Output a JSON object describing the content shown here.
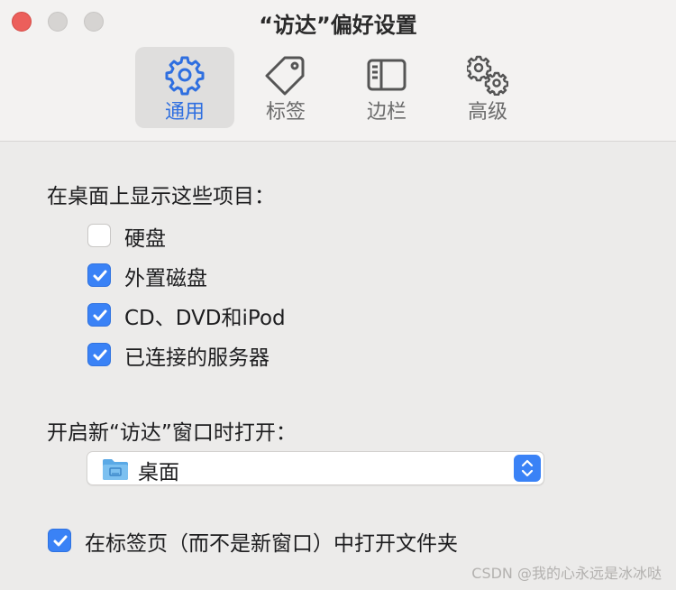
{
  "window": {
    "title": "“访达”偏好设置"
  },
  "toolbar": {
    "tabs": [
      {
        "label": "通用",
        "icon": "gear-icon",
        "selected": true
      },
      {
        "label": "标签",
        "icon": "tag-icon",
        "selected": false
      },
      {
        "label": "边栏",
        "icon": "sidebar-icon",
        "selected": false
      },
      {
        "label": "高级",
        "icon": "gears-advanced-icon",
        "selected": false
      }
    ]
  },
  "desktop_section": {
    "heading": "在桌面上显示这些项目：",
    "items": [
      {
        "label": "硬盘",
        "checked": false
      },
      {
        "label": "外置磁盘",
        "checked": true
      },
      {
        "label": "CD、DVD和iPod",
        "checked": true
      },
      {
        "label": "已连接的服务器",
        "checked": true
      }
    ]
  },
  "new_window_section": {
    "heading": "开启新“访达”窗口时打开：",
    "selected_value": "桌面",
    "icon": "desktop-folder-icon"
  },
  "tabs_option": {
    "label": "在标签页（而不是新窗口）中打开文件夹",
    "checked": true
  },
  "watermark": {
    "text": "CSDN @我的心永远是冰冰哒"
  },
  "colors": {
    "accent": "#3a82f6",
    "close": "#ec5f5b",
    "selected_tab_text": "#2f6fe0"
  }
}
